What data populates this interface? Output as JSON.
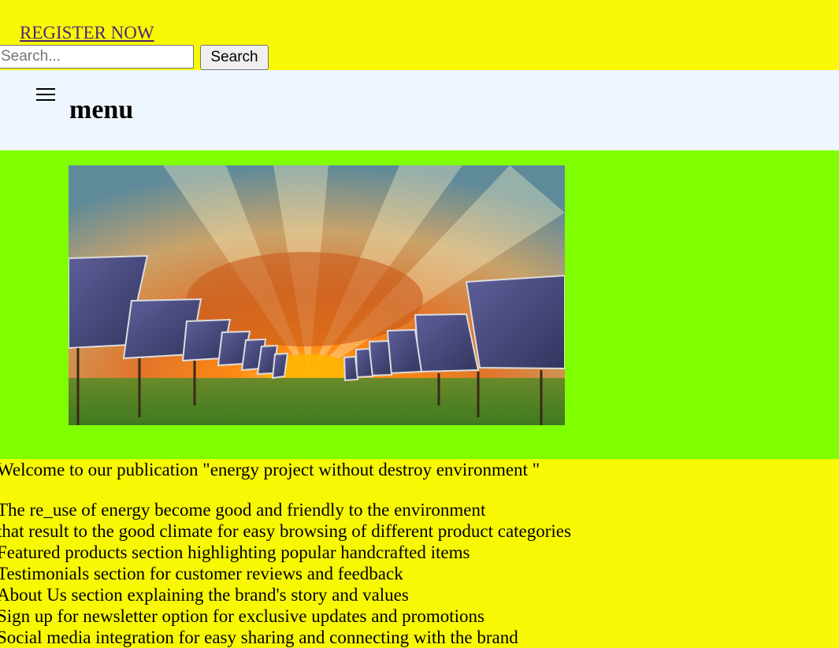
{
  "header": {
    "register_link": "REGISTER NOW",
    "search_placeholder": "Search...",
    "search_value": "",
    "search_button": "Search"
  },
  "nav": {
    "menu_icon": "hamburger-icon",
    "menu_label": "menu"
  },
  "hero": {
    "image_subject": "solar-panels-sunset-image"
  },
  "content": {
    "welcome": "Welcome to our publication \"energy project without destroy environment \"",
    "features": [
      "The re_use of energy become good and friendly to the environment",
      "that result to the good climate for easy browsing of different product categories",
      "Featured products section highlighting popular handcrafted items",
      "Testimonials section for customer reviews and feedback",
      "About Us section explaining the brand's story and values",
      "Sign up for newsletter option for exclusive updates and promotions",
      "Social media integration for easy sharing and connecting with the brand"
    ]
  },
  "colors": {
    "page_background": "#f8f804",
    "nav_background": "#eef6ff",
    "hero_background": "#80ff00",
    "link_color": "#4b2a72"
  }
}
